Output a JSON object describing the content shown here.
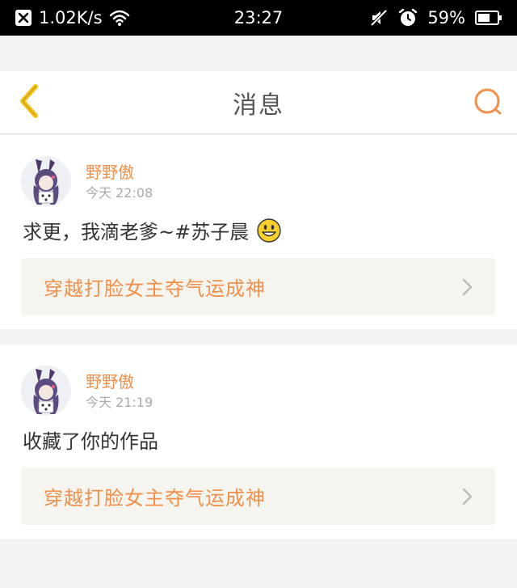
{
  "status_bar": {
    "net_speed": "1.02K/s",
    "time": "23:27",
    "battery": "59%"
  },
  "header": {
    "title": "消息"
  },
  "messages": [
    {
      "username": "野野傲",
      "time": "今天 22:08",
      "text": "求更，我滴老爹~#苏子晨",
      "book_title": "穿越打脸女主夺气运成神"
    },
    {
      "username": "野野傲",
      "time": "今天 21:19",
      "text": "收藏了你的作品",
      "book_title": "穿越打脸女主夺气运成神"
    }
  ],
  "colors": {
    "accent": "#f0904a",
    "back_arrow": "#f5c21b",
    "card_bg": "#f5f4ef"
  },
  "icons": {
    "notification": "close-box-icon",
    "wifi": "wifi-icon",
    "mute": "mute-icon",
    "alarm": "alarm-icon",
    "battery": "battery-icon",
    "back": "chevron-left-icon",
    "search": "search-icon",
    "emoji": "smiley-icon",
    "link_arrow": "chevron-right-icon"
  }
}
